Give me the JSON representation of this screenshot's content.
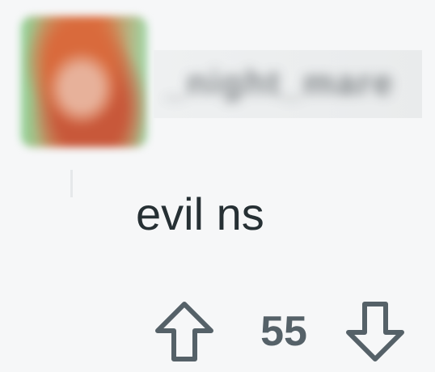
{
  "comment": {
    "username": "_night_mare",
    "body": "evil ns",
    "score": "55"
  },
  "icons": {
    "upvote": "arrow-up-icon",
    "downvote": "arrow-down-icon"
  },
  "colors": {
    "background": "#f6f7f8",
    "text": "#263034",
    "icon": "#556168"
  }
}
